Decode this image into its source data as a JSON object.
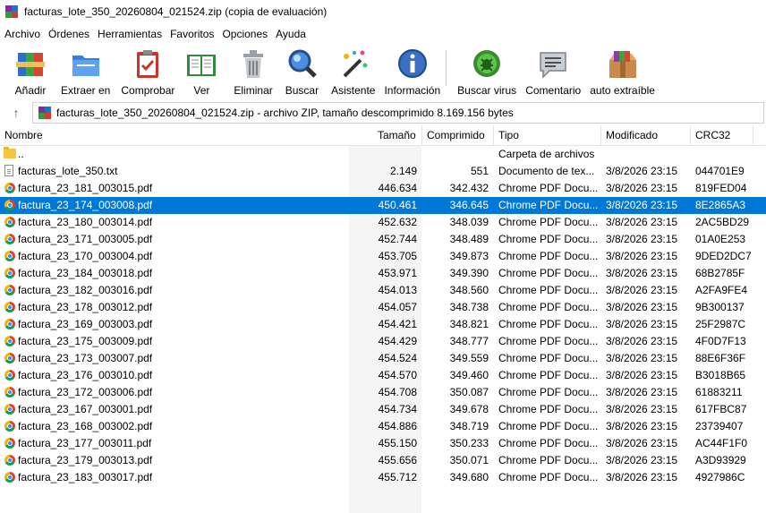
{
  "window": {
    "title": "facturas_lote_350_20260804_021524.zip (copia de evaluación)"
  },
  "menu": [
    "Archivo",
    "Órdenes",
    "Herramientas",
    "Favoritos",
    "Opciones",
    "Ayuda"
  ],
  "toolbar": [
    {
      "label": "Añadir",
      "icon": "add-archive-icon"
    },
    {
      "label": "Extraer en",
      "icon": "extract-folder-icon"
    },
    {
      "label": "Comprobar",
      "icon": "test-clipboard-icon"
    },
    {
      "label": "Ver",
      "icon": "view-book-icon"
    },
    {
      "label": "Eliminar",
      "icon": "trash-icon"
    },
    {
      "label": "Buscar",
      "icon": "magnifier-icon"
    },
    {
      "label": "Asistente",
      "icon": "wizard-wand-icon"
    },
    {
      "label": "Información",
      "icon": "info-icon"
    },
    {
      "label": "Buscar virus",
      "icon": "virus-scan-icon"
    },
    {
      "label": "Comentario",
      "icon": "comment-icon"
    },
    {
      "label": "auto extraíble",
      "icon": "sfx-box-icon"
    }
  ],
  "address": "facturas_lote_350_20260804_021524.zip - archivo ZIP, tamaño descomprimido 8.169.156 bytes",
  "columns": {
    "name": "Nombre",
    "size": "Tamaño",
    "packed": "Comprimido",
    "type": "Tipo",
    "modified": "Modificado",
    "crc": "CRC32"
  },
  "rows": [
    {
      "name": "..",
      "size": "",
      "packed": "",
      "type": "Carpeta de archivos",
      "modified": "",
      "crc": "",
      "kind": "folder"
    },
    {
      "name": "facturas_lote_350.txt",
      "size": "2.149",
      "packed": "551",
      "type": "Documento de tex...",
      "modified": "3/8/2026 23:15",
      "crc": "044701E9",
      "kind": "text"
    },
    {
      "name": "factura_23_181_003015.pdf",
      "size": "446.634",
      "packed": "342.432",
      "type": "Chrome PDF Docu...",
      "modified": "3/8/2026 23:15",
      "crc": "819FED04",
      "kind": "pdf"
    },
    {
      "name": "factura_23_174_003008.pdf",
      "size": "450.461",
      "packed": "346.645",
      "type": "Chrome PDF Docu...",
      "modified": "3/8/2026 23:15",
      "crc": "8E2865A3",
      "kind": "pdf",
      "selected": true
    },
    {
      "name": "factura_23_180_003014.pdf",
      "size": "452.632",
      "packed": "348.039",
      "type": "Chrome PDF Docu...",
      "modified": "3/8/2026 23:15",
      "crc": "2AC5BD29",
      "kind": "pdf"
    },
    {
      "name": "factura_23_171_003005.pdf",
      "size": "452.744",
      "packed": "348.489",
      "type": "Chrome PDF Docu...",
      "modified": "3/8/2026 23:15",
      "crc": "01A0E253",
      "kind": "pdf"
    },
    {
      "name": "factura_23_170_003004.pdf",
      "size": "453.705",
      "packed": "349.873",
      "type": "Chrome PDF Docu...",
      "modified": "3/8/2026 23:15",
      "crc": "9DED2DC7",
      "kind": "pdf"
    },
    {
      "name": "factura_23_184_003018.pdf",
      "size": "453.971",
      "packed": "349.390",
      "type": "Chrome PDF Docu...",
      "modified": "3/8/2026 23:15",
      "crc": "68B2785F",
      "kind": "pdf"
    },
    {
      "name": "factura_23_182_003016.pdf",
      "size": "454.013",
      "packed": "348.560",
      "type": "Chrome PDF Docu...",
      "modified": "3/8/2026 23:15",
      "crc": "A2FA9FE4",
      "kind": "pdf"
    },
    {
      "name": "factura_23_178_003012.pdf",
      "size": "454.057",
      "packed": "348.738",
      "type": "Chrome PDF Docu...",
      "modified": "3/8/2026 23:15",
      "crc": "9B300137",
      "kind": "pdf"
    },
    {
      "name": "factura_23_169_003003.pdf",
      "size": "454.421",
      "packed": "348.821",
      "type": "Chrome PDF Docu...",
      "modified": "3/8/2026 23:15",
      "crc": "25F2987C",
      "kind": "pdf"
    },
    {
      "name": "factura_23_175_003009.pdf",
      "size": "454.429",
      "packed": "348.777",
      "type": "Chrome PDF Docu...",
      "modified": "3/8/2026 23:15",
      "crc": "4F0D7F13",
      "kind": "pdf"
    },
    {
      "name": "factura_23_173_003007.pdf",
      "size": "454.524",
      "packed": "349.559",
      "type": "Chrome PDF Docu...",
      "modified": "3/8/2026 23:15",
      "crc": "88E6F36F",
      "kind": "pdf"
    },
    {
      "name": "factura_23_176_003010.pdf",
      "size": "454.570",
      "packed": "349.460",
      "type": "Chrome PDF Docu...",
      "modified": "3/8/2026 23:15",
      "crc": "B3018B65",
      "kind": "pdf"
    },
    {
      "name": "factura_23_172_003006.pdf",
      "size": "454.708",
      "packed": "350.087",
      "type": "Chrome PDF Docu...",
      "modified": "3/8/2026 23:15",
      "crc": "61883211",
      "kind": "pdf"
    },
    {
      "name": "factura_23_167_003001.pdf",
      "size": "454.734",
      "packed": "349.678",
      "type": "Chrome PDF Docu...",
      "modified": "3/8/2026 23:15",
      "crc": "617FBC87",
      "kind": "pdf"
    },
    {
      "name": "factura_23_168_003002.pdf",
      "size": "454.886",
      "packed": "348.719",
      "type": "Chrome PDF Docu...",
      "modified": "3/8/2026 23:15",
      "crc": "23739407",
      "kind": "pdf"
    },
    {
      "name": "factura_23_177_003011.pdf",
      "size": "455.150",
      "packed": "350.233",
      "type": "Chrome PDF Docu...",
      "modified": "3/8/2026 23:15",
      "crc": "AC44F1F0",
      "kind": "pdf"
    },
    {
      "name": "factura_23_179_003013.pdf",
      "size": "455.656",
      "packed": "350.071",
      "type": "Chrome PDF Docu...",
      "modified": "3/8/2026 23:15",
      "crc": "A3D93929",
      "kind": "pdf"
    },
    {
      "name": "factura_23_183_003017.pdf",
      "size": "455.712",
      "packed": "349.680",
      "type": "Chrome PDF Docu...",
      "modified": "3/8/2026 23:15",
      "crc": "4927986C",
      "kind": "pdf"
    }
  ],
  "colors": {
    "selection": "#0078d7",
    "size_column_bg": "#f5f5f5"
  }
}
